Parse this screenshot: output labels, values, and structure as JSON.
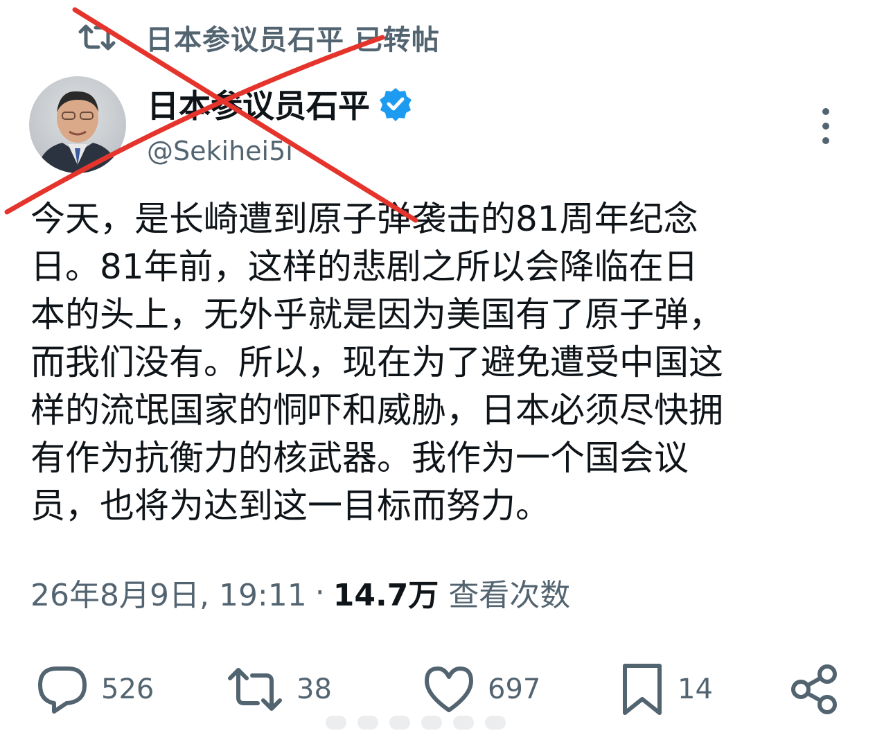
{
  "retweet_header": {
    "text": "日本参议员石平 已转帖"
  },
  "author": {
    "display_name": "日本参议员石平",
    "handle": "@Sekihei5i"
  },
  "tweet": {
    "lines": [
      "今天，是长崎遭到原子弹袭击的81周年纪念",
      "日。81年前，这样的悲剧之所以会降临在日",
      "本的头上，无外乎就是因为美国有了原子弹，",
      "而我们没有。所以，现在为了避免遭受中国这",
      "样的流氓国家的恫吓和威胁，日本必须尽快拥",
      "有作为抗衡力的核武器。我作为一个国会议",
      "员，也将为达到这一目标而努力。"
    ]
  },
  "meta": {
    "timestamp": "26年8月9日, 19:11",
    "separator": "·",
    "views": "14.7万",
    "views_label": "查看次数"
  },
  "actions": {
    "replies": "526",
    "reposts": "38",
    "likes": "697",
    "bookmarks": "14"
  },
  "colors": {
    "cross": "#e5342c",
    "verified": "#1d9bf0",
    "secondary_text": "#536471",
    "primary_text": "#0f1419"
  },
  "icons": [
    "retweet-icon",
    "verified-badge-icon",
    "more-icon",
    "reply-icon",
    "repost-icon",
    "like-icon",
    "bookmark-icon",
    "share-icon"
  ]
}
